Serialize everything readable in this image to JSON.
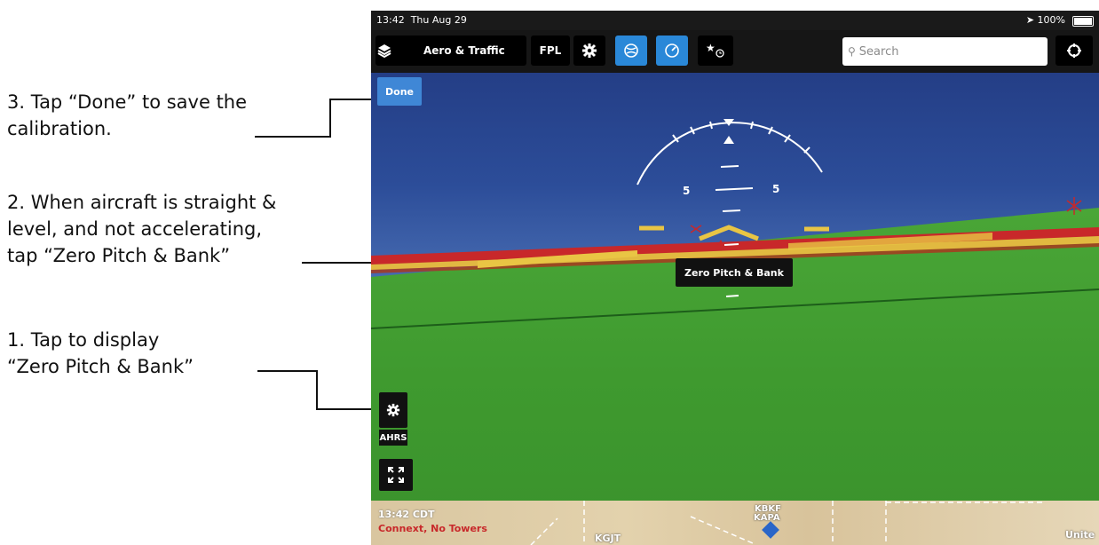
{
  "annotations": {
    "step3": {
      "lines": [
        "3. Tap “Done” to save the",
        "calibration."
      ]
    },
    "step2": {
      "lines": [
        "2. When aircraft is straight &",
        "level, and not accelerating,",
        "tap “Zero Pitch & Bank”"
      ]
    },
    "step1": {
      "lines": [
        "1. Tap to display",
        "“Zero Pitch & Bank”"
      ]
    }
  },
  "status_bar": {
    "time": "13:42",
    "date": "Thu Aug 29",
    "battery": "100%"
  },
  "toolbar": {
    "layer_label": "Aero & Traffic",
    "fpl_label": "FPL",
    "search_placeholder": "Search"
  },
  "attitude": {
    "pitch_left": "5",
    "pitch_right": "5"
  },
  "buttons": {
    "done": "Done",
    "zero_pitch_bank": "Zero Pitch & Bank",
    "ahrs": "AHRS"
  },
  "map_strip": {
    "time": "13:42 CDT",
    "connext": "Connext, No Towers",
    "kgjt": "KGJT",
    "kapa": "KAPA",
    "kbkf": "KBKF",
    "unite": "Unite"
  },
  "colors": {
    "done_blue": "#3f87d6",
    "toolbar_blue": "#2a88d8",
    "ground_green": "#3f9f2e",
    "horizon_yellow": "#e9c544",
    "horizon_red": "#c8282a"
  },
  "icons": [
    "layers-icon",
    "gear-icon",
    "globe-icon",
    "gauge-icon",
    "star-clock-icon",
    "search-icon",
    "crosshair-icon",
    "expand-icon"
  ]
}
